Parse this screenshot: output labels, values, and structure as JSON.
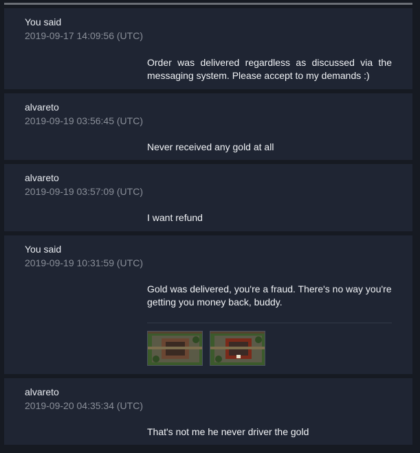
{
  "messages": [
    {
      "author": "You said",
      "timestamp": "2019-09-17 14:09:56 (UTC)",
      "text": "Order was delivered regardless as discussed via the messaging system. Please accept to my demands :)"
    },
    {
      "author": "alvareto",
      "timestamp": "2019-09-19 03:56:45 (UTC)",
      "text": "Never received any gold at all"
    },
    {
      "author": "alvareto",
      "timestamp": "2019-09-19 03:57:09 (UTC)",
      "text": "I want refund"
    },
    {
      "author": "You said",
      "timestamp": "2019-09-19 10:31:59 (UTC)",
      "text": "Gold was delivered, you're a fraud. There's no way you're getting you money back, buddy.",
      "attachments": [
        {
          "icon": "screenshot-thumbnail-1",
          "accent": "#7a4a2a"
        },
        {
          "icon": "screenshot-thumbnail-2",
          "accent": "#8a2a1a"
        }
      ]
    },
    {
      "author": "alvareto",
      "timestamp": "2019-09-20 04:35:34 (UTC)",
      "text": "That's not me he never driver the gold"
    }
  ],
  "colors": {
    "page_bg": "#161a22",
    "card_bg": "#1f2533",
    "text_primary": "#e9ecf1",
    "text_muted": "#8a8f99"
  }
}
